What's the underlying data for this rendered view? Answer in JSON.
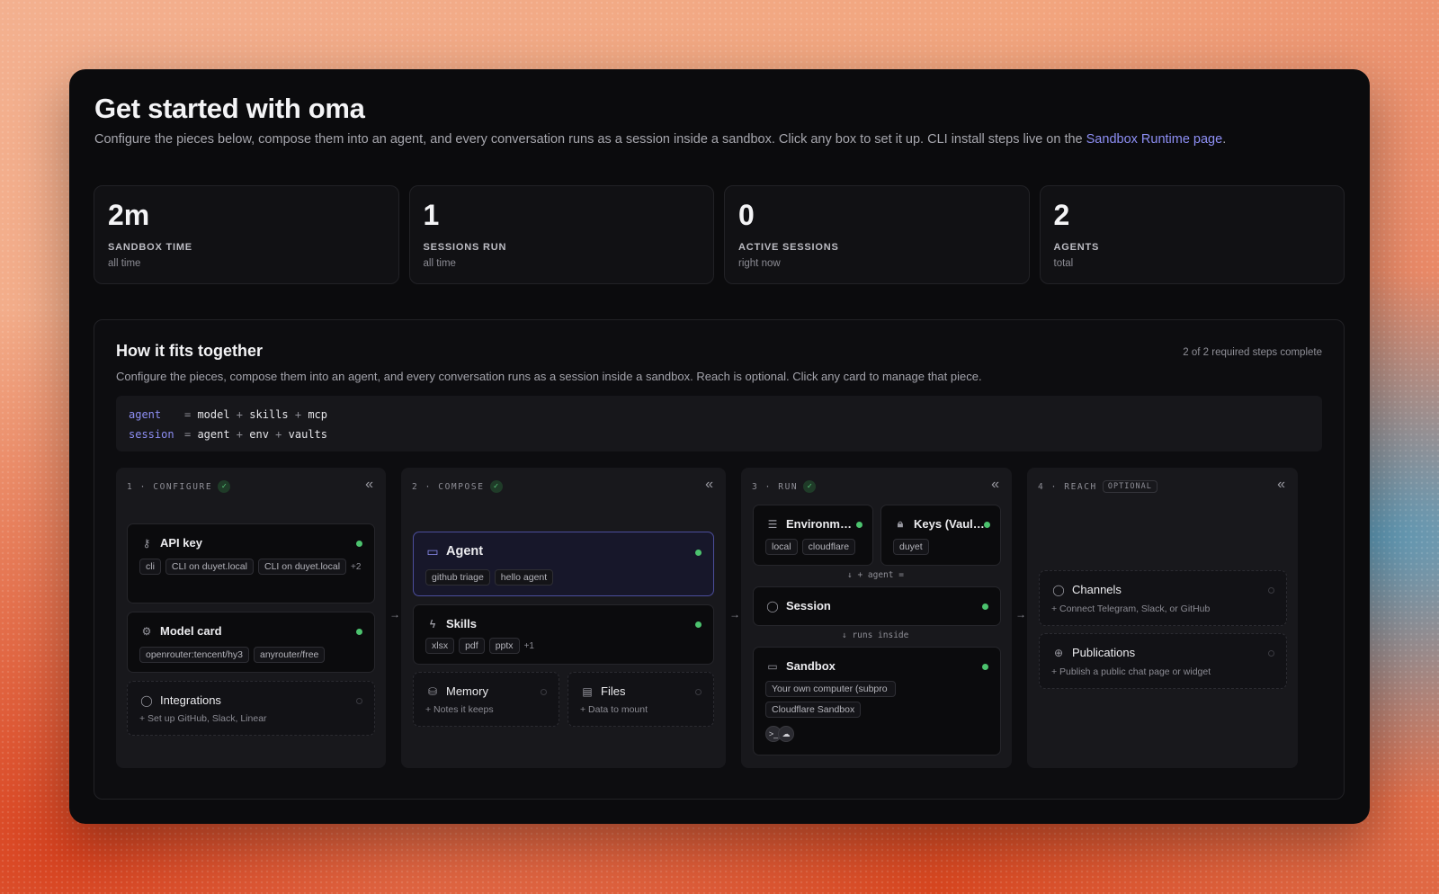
{
  "header": {
    "title": "Get started with oma",
    "subtitle": "Configure the pieces below, compose them into an agent, and every conversation runs as a session inside a sandbox. Click any box to set it up. CLI install steps live on the",
    "link_text": "Sandbox Runtime page",
    "link_suffix": "."
  },
  "stats": [
    {
      "value": "2m",
      "label": "SANDBOX TIME",
      "sub": "all time"
    },
    {
      "value": "1",
      "label": "SESSIONS RUN",
      "sub": "all time"
    },
    {
      "value": "0",
      "label": "ACTIVE SESSIONS",
      "sub": "right now"
    },
    {
      "value": "2",
      "label": "AGENTS",
      "sub": "total"
    }
  ],
  "panel": {
    "title": "How it fits together",
    "status": "2 of 2 required steps complete",
    "description": "Configure the pieces, compose them into an agent, and every conversation runs as a session inside a sandbox. Reach is optional. Click any card to manage that piece.",
    "formula": [
      {
        "key": "agent",
        "parts": [
          "model",
          "skills",
          "mcp"
        ]
      },
      {
        "key": "session",
        "parts": [
          "agent",
          "env",
          "vaults"
        ]
      }
    ]
  },
  "columns": {
    "configure": {
      "label": "1 · CONFIGURE",
      "api_key": {
        "title": "API key",
        "chips": [
          "cli",
          "CLI on duyet.local",
          "CLI on duyet.local"
        ],
        "more": "+2"
      },
      "model_card": {
        "title": "Model card",
        "chips": [
          "openrouter:tencent/hy3",
          "anyrouter/free"
        ]
      },
      "integrations": {
        "title": "Integrations",
        "sub": "+ Set up GitHub, Slack, Linear"
      }
    },
    "compose": {
      "label": "2 · COMPOSE",
      "agent": {
        "title": "Agent",
        "chips": [
          "github triage",
          "hello agent"
        ]
      },
      "skills": {
        "title": "Skills",
        "chips": [
          "xlsx",
          "pdf",
          "pptx"
        ],
        "more": "+1"
      },
      "memory": {
        "title": "Memory",
        "sub": "+ Notes it keeps"
      },
      "files": {
        "title": "Files",
        "sub": "+ Data to mount"
      }
    },
    "run": {
      "label": "3 · RUN",
      "environments": {
        "title": "Environm…",
        "chips": [
          "local",
          "cloudflare"
        ]
      },
      "keys": {
        "title": "Keys (Vaul…",
        "chips": [
          "duyet"
        ]
      },
      "flow_agent": "↓ + agent =",
      "session": {
        "title": "Session"
      },
      "flow_runs": "↓ runs inside",
      "sandbox": {
        "title": "Sandbox",
        "chips": [
          "Your own computer (subpro",
          "Cloudflare Sandbox"
        ],
        "icons": [
          ">_",
          "☁"
        ]
      }
    },
    "reach": {
      "label": "4 · REACH",
      "badge": "OPTIONAL",
      "channels": {
        "title": "Channels",
        "sub": "+ Connect Telegram, Slack, or GitHub"
      },
      "publications": {
        "title": "Publications",
        "sub": "+ Publish a public chat page or widget"
      }
    }
  },
  "colors": {
    "accent": "#8e8ff5",
    "status_ok": "#4cc36e",
    "window_bg": "#0b0b0d"
  }
}
